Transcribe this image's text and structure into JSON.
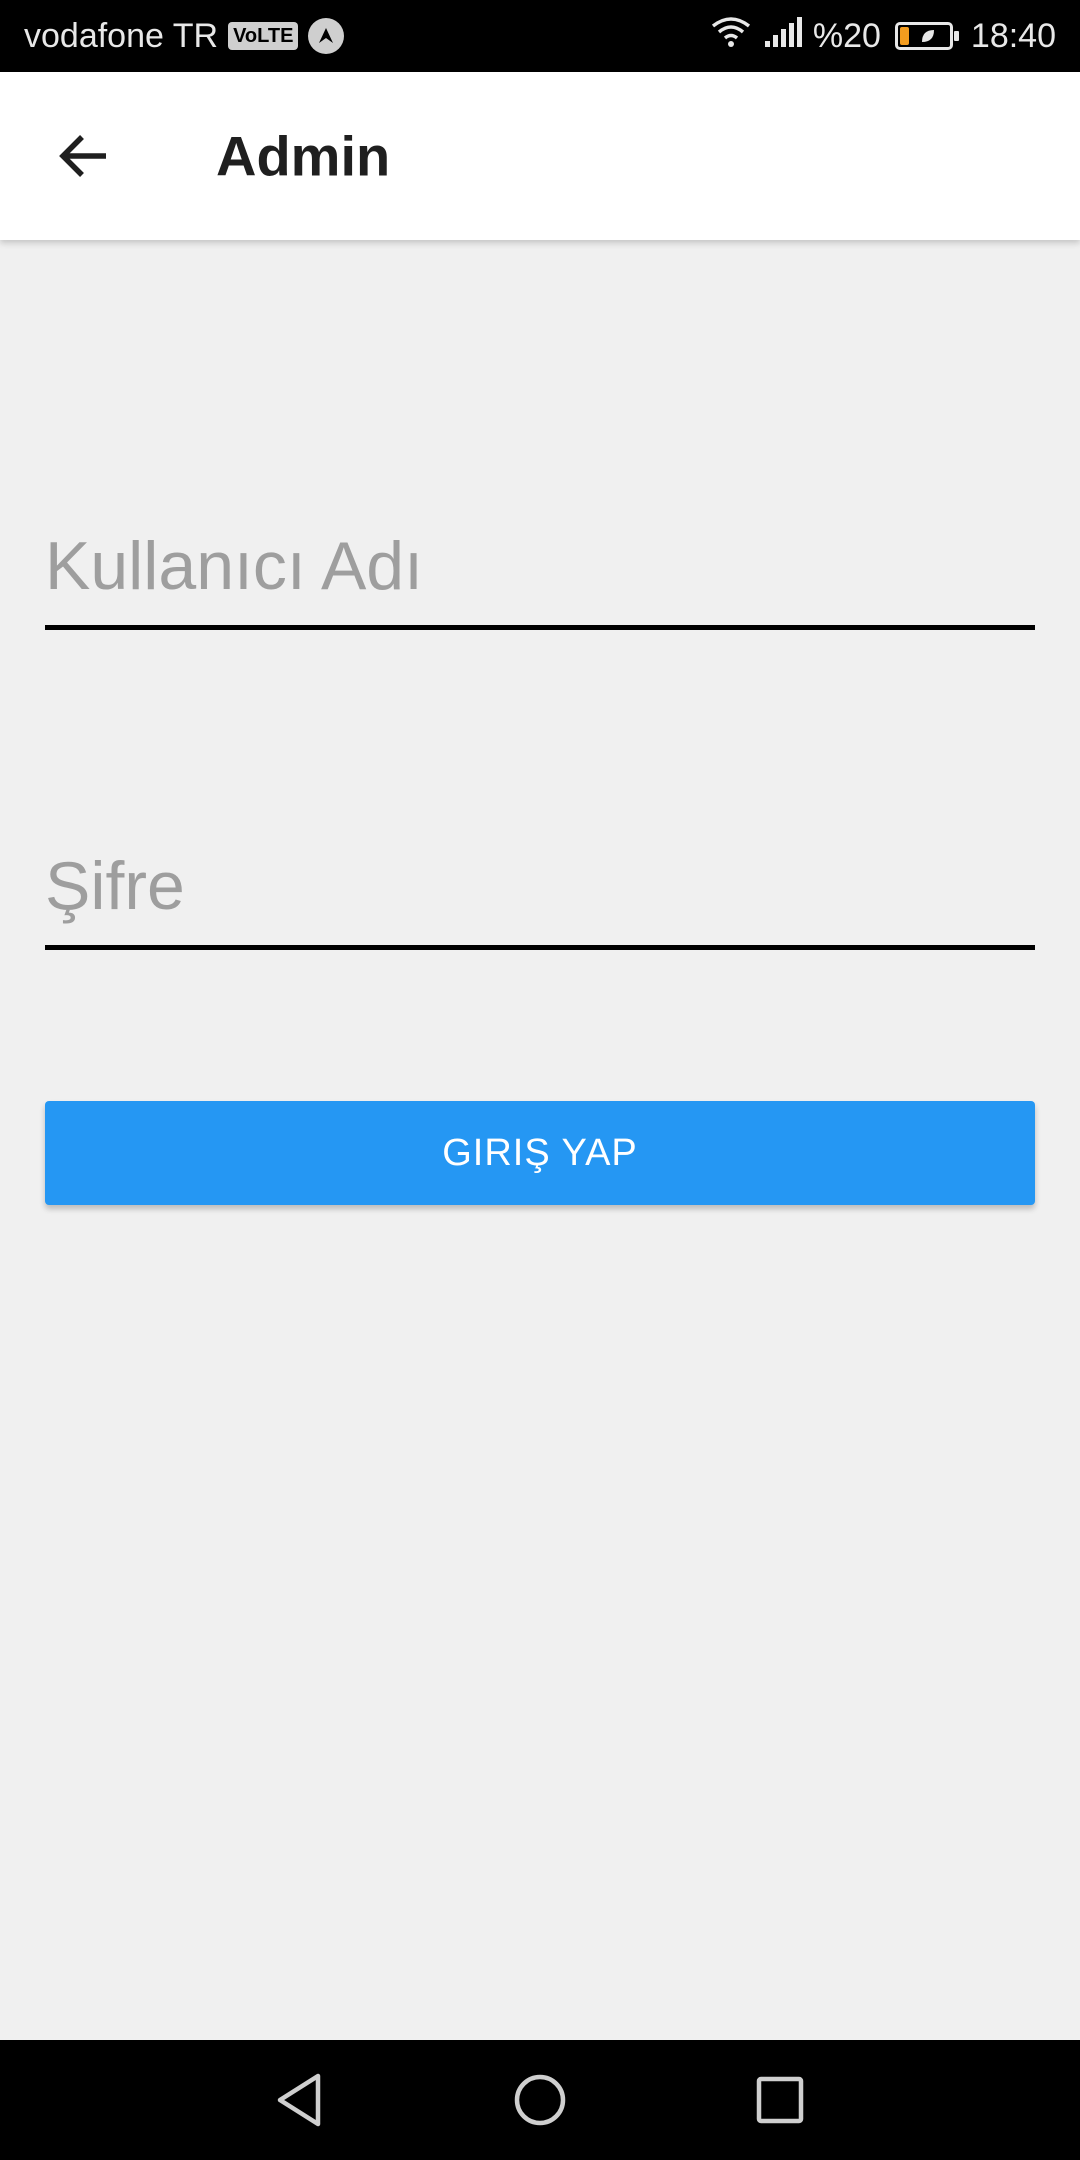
{
  "status_bar": {
    "carrier": "vodafone TR",
    "volte": "VoLTE",
    "battery_percent": "%20",
    "battery_level": 0.2,
    "time": "18:40",
    "colors": {
      "battery_fill": "#f39c1e"
    }
  },
  "app_bar": {
    "title": "Admin",
    "back_icon": "arrow-back-icon"
  },
  "form": {
    "username": {
      "placeholder": "Kullanıcı Adı",
      "value": ""
    },
    "password": {
      "placeholder": "Şifre",
      "value": ""
    },
    "login_label": "GIRIŞ YAP"
  },
  "navigation_bar": {
    "icons": [
      "back-triangle-icon",
      "home-circle-icon",
      "recent-square-icon"
    ]
  },
  "colors": {
    "accent": "#2597f3",
    "background": "#f0f0f0",
    "app_bar": "#ffffff"
  }
}
